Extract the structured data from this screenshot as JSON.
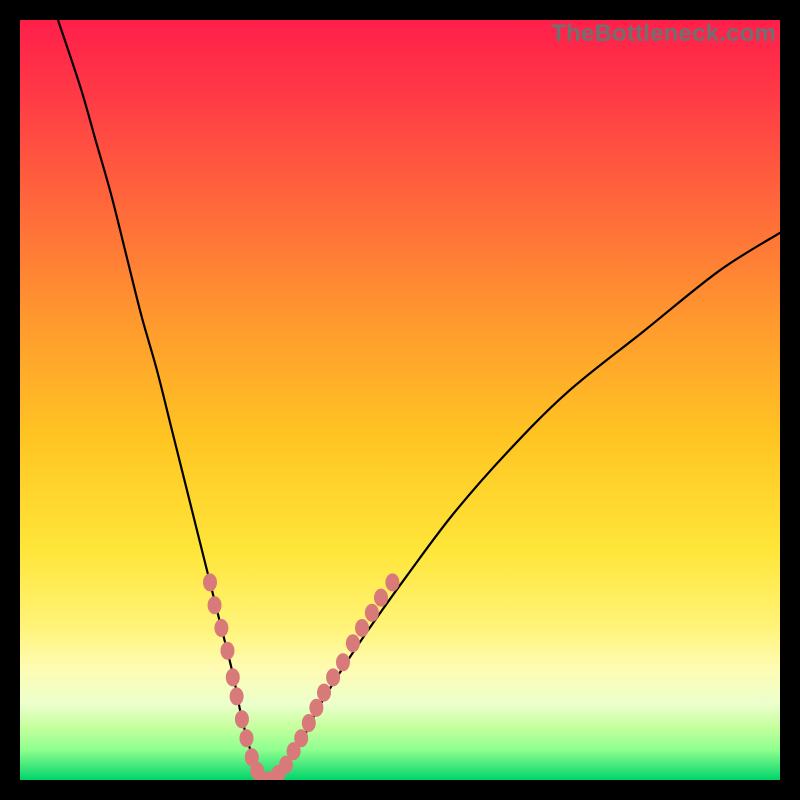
{
  "watermark": {
    "text": "TheBottleneck.com"
  },
  "colors": {
    "gradient_top": "#ff1744",
    "gradient_mid1": "#ff7a00",
    "gradient_mid2": "#ffd400",
    "gradient_mid3": "#fff176",
    "gradient_near_bottom": "#c8ff8a",
    "gradient_bottom": "#00e676",
    "curve": "#000000",
    "markers": "#d97a7a",
    "frame": "#000000"
  },
  "chart_data": {
    "type": "line",
    "title": "",
    "xlabel": "",
    "ylabel": "",
    "xlim": [
      0,
      100
    ],
    "ylim": [
      0,
      100
    ],
    "grid": false,
    "series": [
      {
        "name": "bottleneck-curve",
        "x": [
          5,
          8,
          10,
          12,
          14,
          16,
          18,
          20,
          22,
          24,
          26,
          28,
          29,
          30,
          31,
          32,
          33,
          34,
          35,
          37,
          39,
          42,
          46,
          51,
          57,
          64,
          72,
          82,
          92,
          100
        ],
        "y": [
          100,
          91,
          84,
          77,
          69,
          61,
          54,
          46,
          38,
          30,
          22,
          14,
          9,
          5,
          2,
          0,
          0,
          1,
          2,
          5,
          9,
          14,
          20,
          27,
          35,
          43,
          51,
          59,
          67,
          72
        ]
      }
    ],
    "markers": {
      "name": "highlighted-segments",
      "points": [
        {
          "x": 25.0,
          "y": 26
        },
        {
          "x": 25.6,
          "y": 23
        },
        {
          "x": 26.5,
          "y": 20
        },
        {
          "x": 27.3,
          "y": 17
        },
        {
          "x": 28.0,
          "y": 13.5
        },
        {
          "x": 28.5,
          "y": 11
        },
        {
          "x": 29.2,
          "y": 8
        },
        {
          "x": 29.8,
          "y": 5.5
        },
        {
          "x": 30.5,
          "y": 3
        },
        {
          "x": 31.2,
          "y": 1.2
        },
        {
          "x": 32.0,
          "y": 0
        },
        {
          "x": 33.0,
          "y": 0
        },
        {
          "x": 34.0,
          "y": 0.8
        },
        {
          "x": 35.0,
          "y": 2
        },
        {
          "x": 36.0,
          "y": 3.8
        },
        {
          "x": 37.0,
          "y": 5.5
        },
        {
          "x": 38.0,
          "y": 7.5
        },
        {
          "x": 39.0,
          "y": 9.5
        },
        {
          "x": 40.0,
          "y": 11.5
        },
        {
          "x": 41.2,
          "y": 13.5
        },
        {
          "x": 42.5,
          "y": 15.5
        },
        {
          "x": 43.8,
          "y": 18
        },
        {
          "x": 45.0,
          "y": 20
        },
        {
          "x": 46.3,
          "y": 22
        },
        {
          "x": 47.5,
          "y": 24
        },
        {
          "x": 49.0,
          "y": 26
        }
      ]
    },
    "optimum_x": 32.5
  }
}
